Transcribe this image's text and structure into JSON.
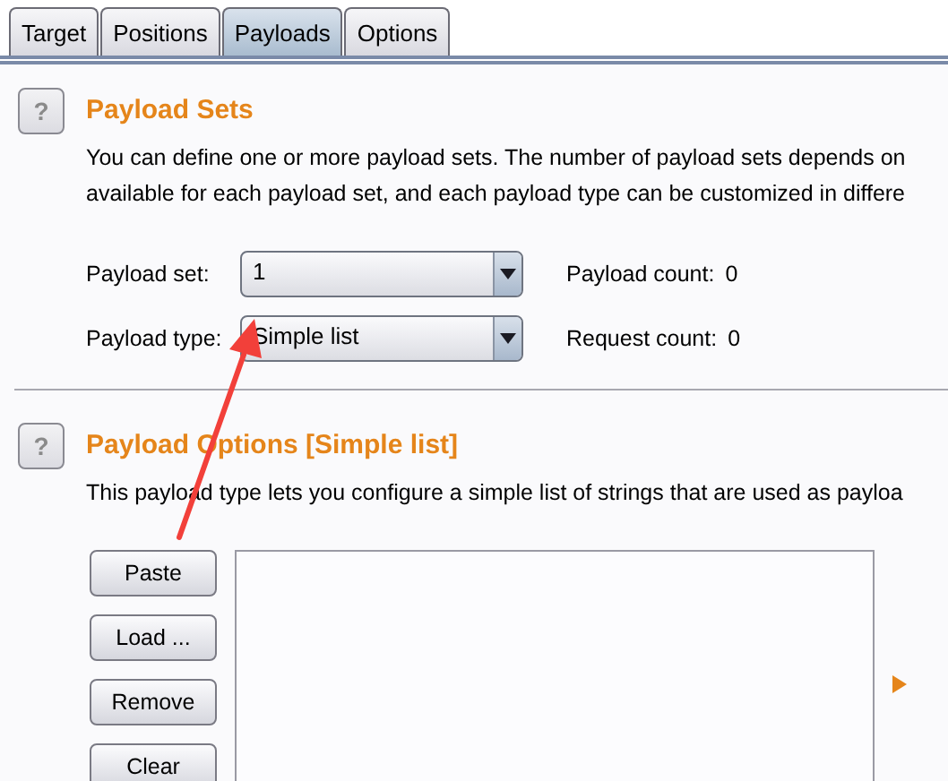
{
  "tabs": [
    {
      "label": "Target",
      "selected": false
    },
    {
      "label": "Positions",
      "selected": false
    },
    {
      "label": "Payloads",
      "selected": true
    },
    {
      "label": "Options",
      "selected": false
    }
  ],
  "payload_sets": {
    "help": "?",
    "title": "Payload Sets",
    "description": [
      "You can define one or more payload sets. The number of payload sets depends on",
      "available for each payload set, and each payload type can be customized in differe"
    ],
    "fields": [
      {
        "label": "Payload set:",
        "value": "1",
        "stat_label": "Payload count:",
        "stat_value": "0"
      },
      {
        "label": "Payload type:",
        "value": "Simple list",
        "stat_label": "Request count:",
        "stat_value": "0"
      }
    ]
  },
  "payload_options": {
    "help": "?",
    "title": "Payload Options [Simple list]",
    "description": [
      "This payload type lets you configure a simple list of strings that are used as payloa"
    ],
    "buttons": [
      "Paste",
      "Load ...",
      "Remove",
      "Clear"
    ]
  },
  "annotations": [
    {
      "kind": "arrow"
    }
  ]
}
